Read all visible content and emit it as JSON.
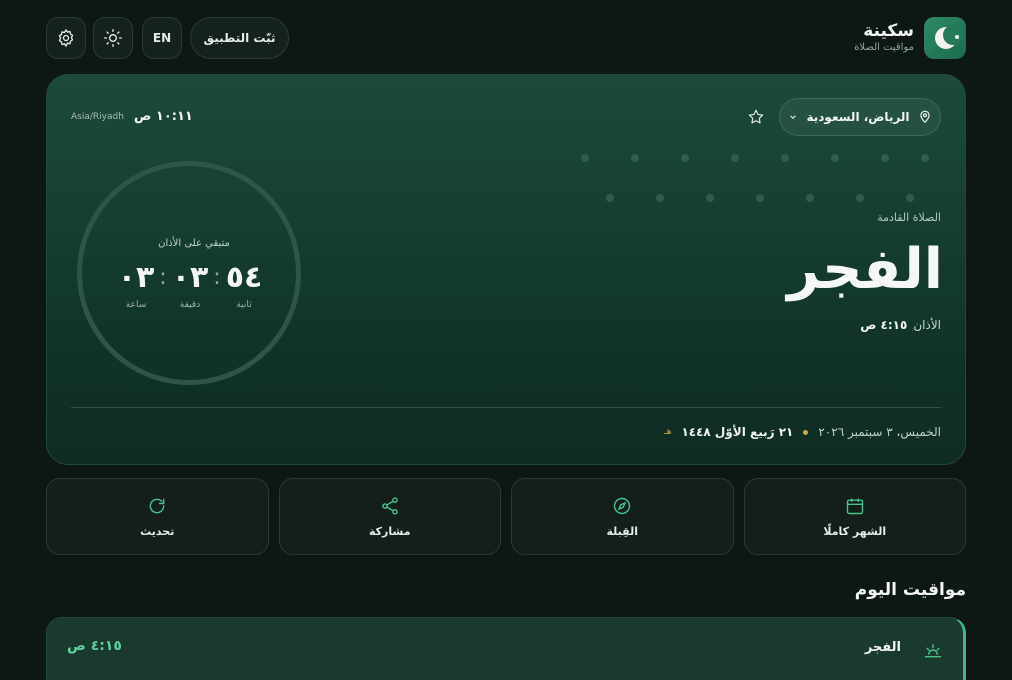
{
  "header": {
    "app_name": "سكينة",
    "app_subtitle": "مواقيت الصلاة",
    "install_label": "ثبّت التطبيق",
    "lang_label": "EN",
    "icons": [
      "settings-icon",
      "sun-icon",
      "crescent-logo"
    ]
  },
  "hero": {
    "location_label": "الرياض، السعودية",
    "timezone": "Asia/Riyadh",
    "current_time": "١٠:١١ ص",
    "next_prayer_label": "الصلاة القادمة",
    "next_prayer_name": "الفجر",
    "adhan_label": "الأذان",
    "adhan_time": "٤:١٥ ص",
    "countdown": {
      "title": "متبقي على الأذان",
      "hours": "٠٣",
      "minutes": "٠٣",
      "seconds": "٥٤",
      "hours_label": "ساعة",
      "minutes_label": "دقيقة",
      "seconds_label": "ثانية"
    },
    "gregorian_date": "الخميس، ٣ سبتمبر ٢٠٢٦",
    "hijri_date": "٢١ رَبيع الأوّل ١٤٤٨",
    "hijri_suffix": "هـ"
  },
  "actions": [
    {
      "label": "الشهر كاملًا",
      "icon": "calendar-icon"
    },
    {
      "label": "القِبلة",
      "icon": "compass-icon"
    },
    {
      "label": "مشاركة",
      "icon": "share-icon"
    },
    {
      "label": "تحديث",
      "icon": "refresh-icon"
    }
  ],
  "today": {
    "title": "مواقيت اليوم",
    "rows": [
      {
        "name": "الفجر",
        "time": "٤:١٥ ص",
        "icon": "sunrise-icon"
      }
    ]
  },
  "colors": {
    "background": "#0d1713",
    "accent": "#3fb883",
    "gold": "#c9a84f"
  }
}
